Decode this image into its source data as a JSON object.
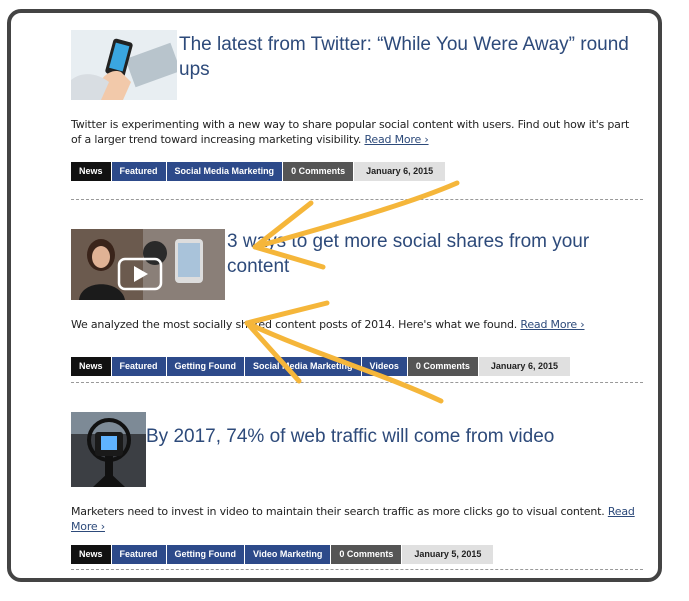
{
  "posts": [
    {
      "title": "The latest from Twitter: “While You Were Away” round ups",
      "excerpt": "Twitter is experimenting with a new way to share popular social content with users. Find out how it's part of a larger trend toward increasing marketing visibility.",
      "read_more": "Read More ›",
      "tags": [
        "News",
        "Featured",
        "Social Media Marketing"
      ],
      "comments": "0 Comments",
      "date": "January 6, 2015"
    },
    {
      "title": "3 ways to get more social shares from your content",
      "excerpt": "We analyzed the most socially shared content posts of 2014. Here's what we found.",
      "read_more": "Read More ›",
      "tags": [
        "News",
        "Featured",
        "Getting Found",
        "Social Media Marketing",
        "Videos"
      ],
      "comments": "0 Comments",
      "date": "January 6, 2015"
    },
    {
      "title": "By 2017, 74% of web traffic will come from video",
      "excerpt": "Marketers need to invest in video to maintain their search traffic as more clicks go to visual content.",
      "read_more": "Read More ›",
      "tags": [
        "News",
        "Featured",
        "Getting Found",
        "Video Marketing"
      ],
      "comments": "0 Comments",
      "date": "January 5, 2015"
    }
  ],
  "colors": {
    "title": "#2d4a7a",
    "tag_blue": "#2d4a8a",
    "tag_black": "#111111",
    "comments": "#555555",
    "date_bg": "#e0e0e0",
    "arrow": "#f5b63a",
    "frame": "#444444"
  },
  "icons": {
    "post1_thumb": "hand-holding-phone-with-twitter-image",
    "post2_thumb": "video-thumbnail-image",
    "post3_thumb": "camera-recording-image"
  }
}
